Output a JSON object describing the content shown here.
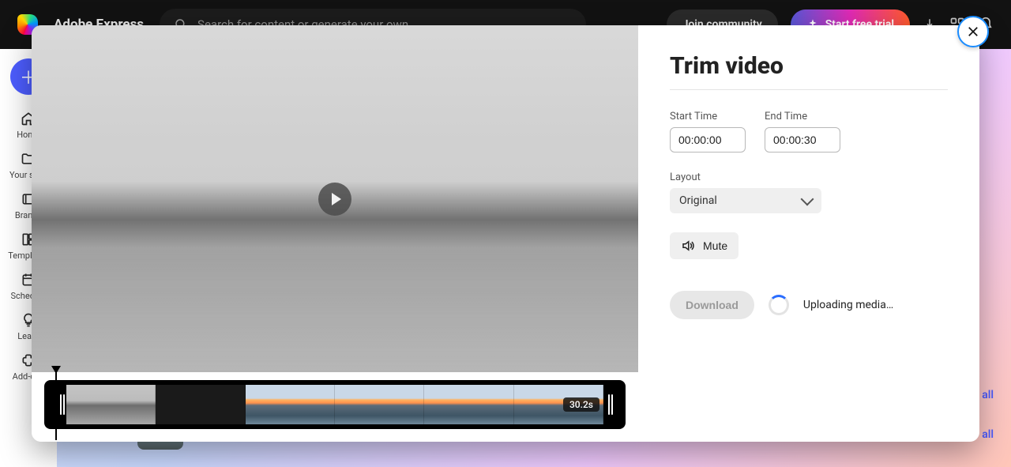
{
  "brand": "Adobe Express",
  "search": {
    "placeholder": "Search for content or generate your own"
  },
  "topbar": {
    "join_label": "Join community",
    "trial_label": "Start free trial"
  },
  "rail": {
    "items": [
      {
        "label": "Home"
      },
      {
        "label": "Your stuff"
      },
      {
        "label": "Brands"
      },
      {
        "label": "Templates"
      },
      {
        "label": "Schedule"
      },
      {
        "label": "Learn"
      },
      {
        "label": "Add-ons"
      }
    ]
  },
  "bg_link": "View all",
  "modal": {
    "title": "Trim video",
    "start_label": "Start Time",
    "end_label": "End Time",
    "start_value": "00:00:00",
    "end_value": "00:00:30",
    "layout_label": "Layout",
    "layout_value": "Original",
    "mute_label": "Mute",
    "download_label": "Download",
    "uploading_label": "Uploading media…",
    "duration_badge": "30.2s"
  }
}
